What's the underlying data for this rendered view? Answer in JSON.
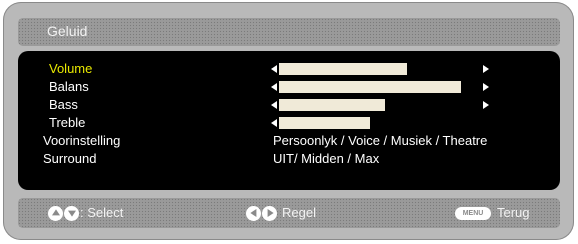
{
  "menu": {
    "title": "Geluid",
    "items": [
      {
        "label": "Volume",
        "type": "slider",
        "level": 0.69,
        "selected": true
      },
      {
        "label": "Balans",
        "type": "slider",
        "level": 0.98,
        "selected": false
      },
      {
        "label": "Bass",
        "type": "slider",
        "level": 0.57,
        "selected": false
      },
      {
        "label": "Treble",
        "type": "slider",
        "level": 0.49,
        "selected": false
      },
      {
        "label": "Voorinstelling",
        "type": "options",
        "value": "Persoonlyk  / Voice / Musiek / Theatre",
        "selected": false
      },
      {
        "label": "Surround",
        "type": "options",
        "value": "UIT/ Midden / Max",
        "selected": false
      }
    ]
  },
  "footer": {
    "select_label": ": Select",
    "adjust_label": "Regel",
    "back_label": "Terug",
    "menu_key_label": "MENU"
  },
  "colors": {
    "selected_text": "#e8e800",
    "normal_text": "#ffffff",
    "bar_fill": "#f0ead8",
    "panel_bg": "#000000",
    "frame_bg": "#b9b9b9"
  },
  "icons": {
    "select": [
      "up-circle-icon",
      "down-circle-icon"
    ],
    "adjust": [
      "left-circle-icon",
      "right-circle-icon"
    ],
    "back": "menu-key-icon"
  }
}
